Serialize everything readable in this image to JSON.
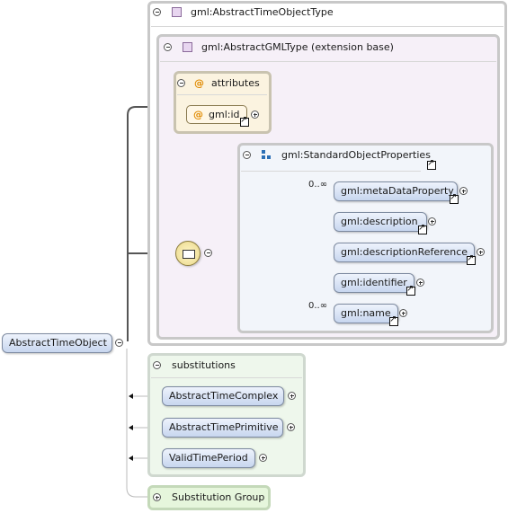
{
  "root_element": {
    "label": "AbstractTimeObject"
  },
  "type": {
    "label": "gml:AbstractTimeObjectType"
  },
  "base_type": {
    "label": "gml:AbstractGMLType (extension base)"
  },
  "attributes": {
    "header": "attributes",
    "items": [
      {
        "label": "gml:id"
      }
    ]
  },
  "std_props": {
    "label": "gml:StandardObjectProperties",
    "elements": [
      {
        "label": "gml:metaDataProperty",
        "cardinality": "0..∞"
      },
      {
        "label": "gml:description",
        "cardinality": ""
      },
      {
        "label": "gml:descriptionReference",
        "cardinality": ""
      },
      {
        "label": "gml:identifier",
        "cardinality": ""
      },
      {
        "label": "gml:name",
        "cardinality": "0..∞"
      }
    ]
  },
  "substitutions": {
    "header": "substitutions",
    "items": [
      {
        "label": "AbstractTimeComplex"
      },
      {
        "label": "AbstractTimePrimitive"
      },
      {
        "label": "ValidTimePeriod"
      }
    ]
  },
  "substitution_group": {
    "label": "Substitution Group"
  },
  "colors": {
    "element_fill": "#c7d6ef",
    "attribute_fill": "#fbf3e0",
    "base_type_fill": "#f6f0f8",
    "substitutions_fill": "#eef7ec",
    "substitution_group_fill": "#e6f6dc",
    "sequence_fill": "#ead88a"
  },
  "icons": [
    "complex-type-icon",
    "attribute-icon",
    "group-icon",
    "sequence-icon",
    "reference-arrow-icon",
    "collapse-icon",
    "expand-icon"
  ]
}
